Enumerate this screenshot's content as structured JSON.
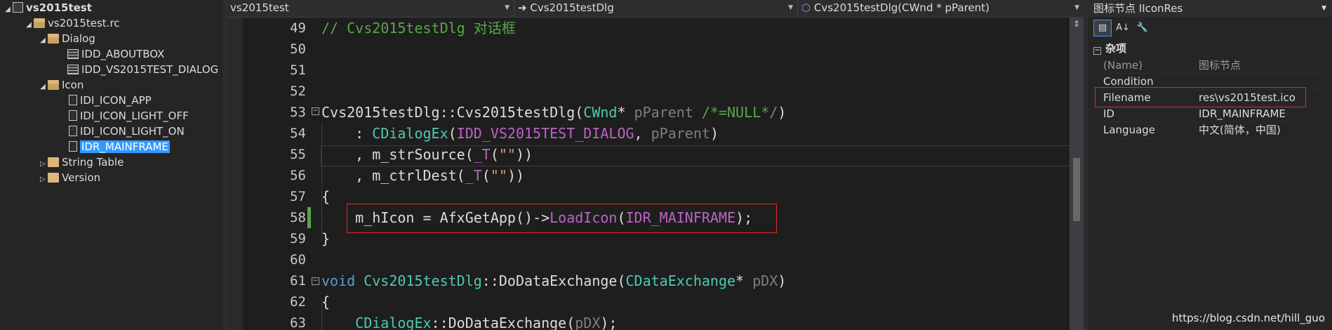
{
  "tree": {
    "nodes": [
      {
        "label": "vs2015test",
        "bold": true
      },
      {
        "label": "vs2015test.rc"
      },
      {
        "label": "Dialog"
      },
      {
        "label": "IDD_ABOUTBOX"
      },
      {
        "label": "IDD_VS2015TEST_DIALOG"
      },
      {
        "label": "Icon"
      },
      {
        "label": "IDI_ICON_APP"
      },
      {
        "label": "IDI_ICON_LIGHT_OFF"
      },
      {
        "label": "IDI_ICON_LIGHT_ON"
      },
      {
        "label": "IDR_MAINFRAME",
        "selected": true
      },
      {
        "label": "String Table"
      },
      {
        "label": "Version"
      }
    ]
  },
  "navbar": {
    "project": "vs2015test",
    "class": "Cvs2015testDlg",
    "member": "Cvs2015testDlg(CWnd * pParent)"
  },
  "code": {
    "line_numbers": [
      "49",
      "50",
      "51",
      "52",
      "53",
      "54",
      "55",
      "56",
      "57",
      "58",
      "59",
      "60",
      "61",
      "62",
      "63"
    ],
    "line49": "// Cvs2015testDlg 对话框",
    "l53_cls": "Cvs2015testDlg::Cvs2015testDlg(",
    "l53_type": "CWnd",
    "l53_ptr": "* ",
    "l53_par": "pParent",
    "l53_com": " /*=NULL*/",
    "l53_end": ")",
    "l54_pre": "    : ",
    "l54_type": "CDialogEx",
    "l54_op": "(",
    "l54_mac": "IDD_VS2015TEST_DIALOG",
    "l54_sep": ", ",
    "l54_par": "pParent",
    "l54_end": ")",
    "l55_pre": "    , m_strSource(",
    "l55_mac": "_T",
    "l55_op": "(",
    "l55_str": "\"\"",
    "l55_end": "))",
    "l56_pre": "    , m_ctrlDest(",
    "l56_mac": "_T",
    "l56_op": "(",
    "l56_str": "\"\"",
    "l56_end": "))",
    "l57": "{",
    "l58_pre": "    m_hIcon = AfxGetApp()->",
    "l58_fn": "LoadIcon",
    "l58_op": "(",
    "l58_mac": "IDR_MAINFRAME",
    "l58_end": ");",
    "l59": "}",
    "l61_kw": "void",
    "l61_sp": " ",
    "l61_type": "Cvs2015testDlg",
    "l61_mid": "::DoDataExchange(",
    "l61_type2": "CDataExchange",
    "l61_ptr": "* ",
    "l61_par": "pDX",
    "l61_end": ")",
    "l62": "{",
    "l63_pre": "    ",
    "l63_type": "CDialogEx",
    "l63_mid": "::DoDataExchange(",
    "l63_par": "pDX",
    "l63_end": ");"
  },
  "props": {
    "title": "图标节点 IIconRes",
    "category": "杂项",
    "rows": [
      {
        "name": "(Name)",
        "value": "图标节点"
      },
      {
        "name": "Condition",
        "value": ""
      },
      {
        "name": "Filename",
        "value": "res\\vs2015test.ico"
      },
      {
        "name": "ID",
        "value": "IDR_MAINFRAME"
      },
      {
        "name": "Language",
        "value": "中文(简体，中国)"
      }
    ]
  },
  "watermark": "https://blog.csdn.net/hill_guo",
  "colors": {
    "highlight_box": "#e0282a",
    "selection": "#3399ff",
    "comment": "#57a64a",
    "keyword": "#569cd6",
    "type": "#4ec9b0",
    "macro": "#bd63c5"
  }
}
